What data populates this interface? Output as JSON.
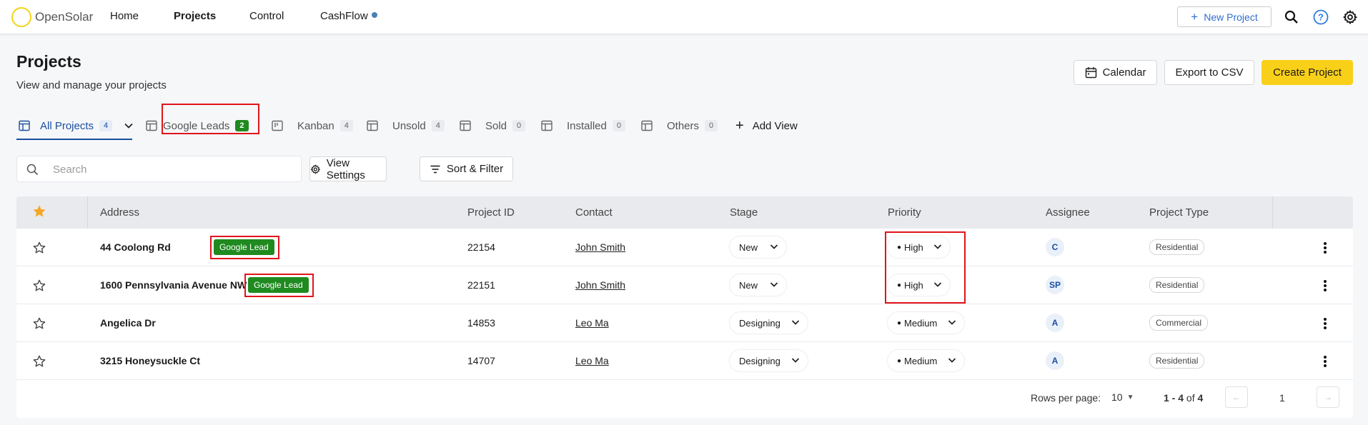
{
  "nav": {
    "logo": "OpenSolar",
    "links": [
      "Home",
      "Projects",
      "Control",
      "CashFlow"
    ],
    "new_project": "New Project"
  },
  "header": {
    "title": "Projects",
    "subtitle": "View and manage your projects",
    "calendar": "Calendar",
    "export": "Export to CSV",
    "create": "Create Project"
  },
  "tabs": [
    {
      "label": "All Projects",
      "count": "4"
    },
    {
      "label": "Google Leads",
      "count": "2"
    },
    {
      "label": "Kanban",
      "count": "4"
    },
    {
      "label": "Unsold",
      "count": "4"
    },
    {
      "label": "Sold",
      "count": "0"
    },
    {
      "label": "Installed",
      "count": "0"
    },
    {
      "label": "Others",
      "count": "0"
    }
  ],
  "add_view": "Add View",
  "toolbar": {
    "search_placeholder": "Search",
    "view_settings": "View Settings",
    "sort_filter": "Sort & Filter"
  },
  "table": {
    "columns": [
      "Address",
      "Project ID",
      "Contact",
      "Stage",
      "Priority",
      "Assignee",
      "Project Type"
    ],
    "badge_label": "Google Lead",
    "rows": [
      {
        "address": "44 Coolong Rd",
        "google_lead": true,
        "id": "22154",
        "contact": "John Smith",
        "stage": "New",
        "priority": "High",
        "assignee": "C",
        "type": "Residential"
      },
      {
        "address": "1600 Pennsylvania Avenue NW",
        "google_lead": true,
        "id": "22151",
        "contact": "John Smith",
        "stage": "New",
        "priority": "High",
        "assignee": "SP",
        "type": "Residential"
      },
      {
        "address": "Angelica Dr",
        "google_lead": false,
        "id": "14853",
        "contact": "Leo Ma",
        "stage": "Designing",
        "priority": "Medium",
        "assignee": "A",
        "type": "Commercial"
      },
      {
        "address": "3215 Honeysuckle Ct",
        "google_lead": false,
        "id": "14707",
        "contact": "Leo Ma",
        "stage": "Designing",
        "priority": "Medium",
        "assignee": "A",
        "type": "Residential"
      }
    ]
  },
  "footer": {
    "rows_per_page_label": "Rows per page:",
    "rows_per_page": "10",
    "range": "1 - 4",
    "of": "of",
    "total": "4",
    "page": "1"
  },
  "colors": {
    "accent": "#1a4fa0",
    "brand_yellow": "#f9d019",
    "lead_green": "#1f8a1f",
    "highlight_red": "#e0141c"
  }
}
